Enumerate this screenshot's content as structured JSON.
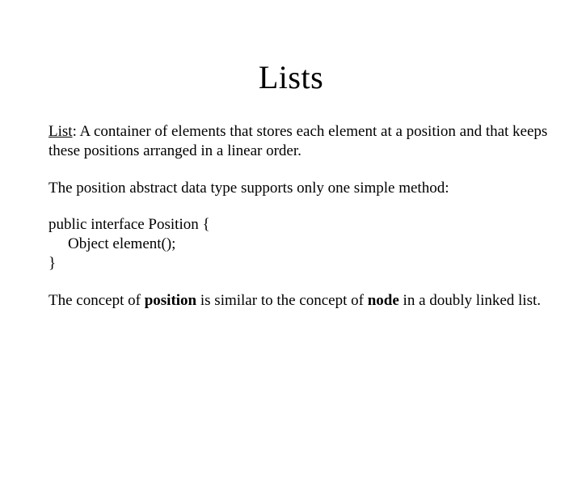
{
  "title": "Lists",
  "p1": {
    "term": "List",
    "rest": ": A container of elements that stores each element at a position and that keeps these positions arranged in a linear order."
  },
  "p2": "The position abstract data type supports only one simple method:",
  "code": {
    "l1": "public interface Position {",
    "l2": "Object element();",
    "l3": "}"
  },
  "p3": {
    "s1": "The concept of ",
    "k1": "position",
    "s2": " is similar to the concept of ",
    "k2": "node",
    "s3": " in a doubly linked list."
  }
}
